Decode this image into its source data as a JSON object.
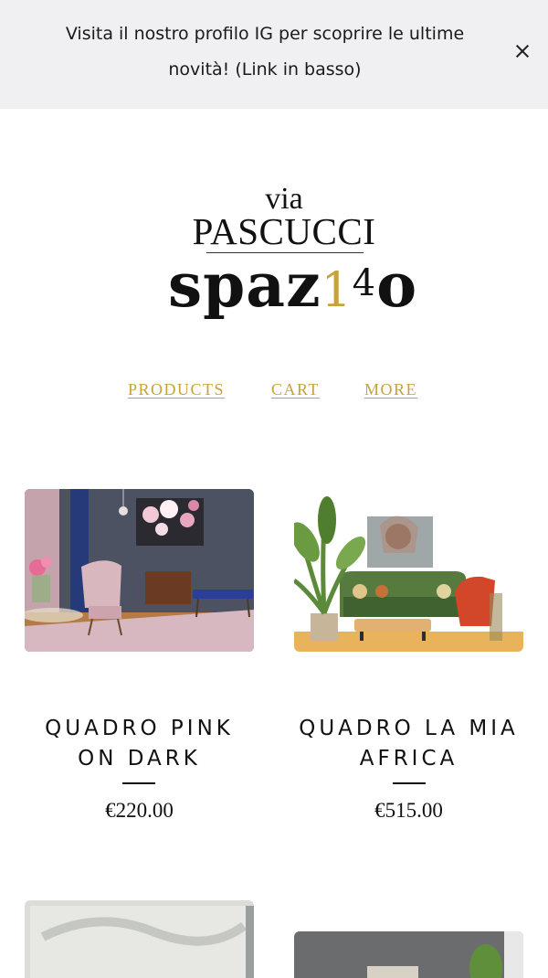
{
  "banner": {
    "text": "Visita il nostro profilo IG per scoprire le ultime novità! (Link in basso)"
  },
  "logo": {
    "line1": "via",
    "line2": "PASCUCCI",
    "line3_word": "spaz",
    "line3_num1": "1",
    "line3_num2": "4",
    "line3_end": "o"
  },
  "nav": {
    "items": [
      {
        "label": "PRODUCTS"
      },
      {
        "label": "CART"
      },
      {
        "label": "MORE"
      }
    ]
  },
  "products": [
    {
      "title": "QUADRO PINK ON DARK",
      "price": "€220.00"
    },
    {
      "title": "QUADRO LA MIA AFRICA",
      "price": "€515.00"
    }
  ],
  "colors": {
    "accent_gold": "#c9a13a",
    "banner_bg": "#f0eff1",
    "text": "#111111"
  }
}
